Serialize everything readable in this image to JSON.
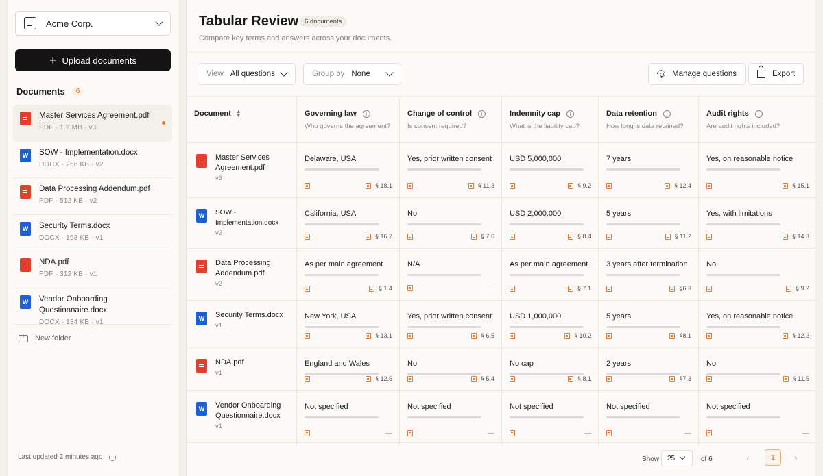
{
  "sidebar": {
    "org": "Acme Corp.",
    "upload_label": "Upload documents",
    "documents_title": "Documents",
    "documents_count": "6",
    "new_folder": "New folder",
    "last_updated": "Last updated 2 minutes ago",
    "docs": [
      {
        "name": "Master Services Agreement.pdf",
        "type": "pdf",
        "meta": "PDF  ·  1.2 MB  ·  v3"
      },
      {
        "name": "SOW - Implementation.docx",
        "type": "doc",
        "meta": "DOCX  ·  256 KB  ·  v2"
      },
      {
        "name": "Data Processing Addendum.pdf",
        "type": "pdf",
        "meta": "PDF  ·  512 KB  ·  v2"
      },
      {
        "name": "Security Terms.docx",
        "type": "doc",
        "meta": "DOCX  ·  198 KB  ·  v1"
      },
      {
        "name": "NDA.pdf",
        "type": "pdf",
        "meta": "PDF  ·  312 KB  ·  v1"
      },
      {
        "name": "Vendor Onboarding Questionnaire.docx",
        "type": "doc",
        "meta": "DOCX  ·  134 KB  ·  v1"
      }
    ]
  },
  "main": {
    "title": "Tabular Review",
    "title_badge": "6 documents",
    "subtitle": "Compare key terms and answers across your documents.",
    "view_label": "View",
    "view_value": "All questions",
    "group_label": "Group by",
    "group_value": "None",
    "manage_label": "Manage questions",
    "export_label": "Export"
  },
  "table": {
    "doc_header": "Document",
    "columns": [
      {
        "title": "Governing law",
        "q": "Who governs the agreement?"
      },
      {
        "title": "Change of control",
        "q": "Is consent required?"
      },
      {
        "title": "Indemnity cap",
        "q": "What is the liability cap?"
      },
      {
        "title": "Data retention",
        "q": "How long is data retained?"
      },
      {
        "title": "Audit rights",
        "q": "Are audit rights included?"
      }
    ],
    "rows": [
      {
        "doc": "Master Services Agreement.pdf",
        "type": "pdf",
        "ver": "v3",
        "cells": [
          [
            "Delaware, USA",
            "§ 18.1"
          ],
          [
            "Yes, prior written consent",
            "§ 11.3"
          ],
          [
            "USD 5,000,000",
            "§ 9.2"
          ],
          [
            "7 years",
            "§ 12.4"
          ],
          [
            "Yes, on reasonable notice",
            "§ 15.1"
          ]
        ]
      },
      {
        "doc": "SOW - Implementation.docx",
        "type": "doc",
        "ver": "v2",
        "cells": [
          [
            "California, USA",
            "§ 16.2"
          ],
          [
            "No",
            "§ 7.6"
          ],
          [
            "USD 2,000,000",
            "§ 8.4"
          ],
          [
            "5 years",
            "§ 11.2"
          ],
          [
            "Yes, with limitations",
            "§ 14.3"
          ]
        ]
      },
      {
        "doc": "Data Processing Addendum.pdf",
        "type": "pdf",
        "ver": "v2",
        "cells": [
          [
            "As per main agreement",
            "§ 1.4"
          ],
          [
            "N/A",
            "—"
          ],
          [
            "As per main agreement",
            "§ 7.1"
          ],
          [
            "3 years after termination",
            "§6.3"
          ],
          [
            "No",
            "§ 9.2"
          ]
        ]
      },
      {
        "doc": "Security Terms.docx",
        "type": "doc",
        "ver": "v1",
        "cells": [
          [
            "New York, USA",
            "§ 13.1"
          ],
          [
            "Yes, prior written consent",
            "§ 6.5"
          ],
          [
            "USD 1,000,000",
            "§ 10.2"
          ],
          [
            "5 years",
            "§8.1"
          ],
          [
            "Yes, on reasonable notice",
            "§ 12.2"
          ]
        ]
      },
      {
        "doc": "NDA.pdf",
        "type": "pdf",
        "ver": "v1",
        "cells": [
          [
            "England and Wales",
            "§ 12.5"
          ],
          [
            "No",
            "§ 5.4"
          ],
          [
            "No cap",
            "§ 8.1"
          ],
          [
            "2 years",
            "§7.3"
          ],
          [
            "No",
            "§ 11.5"
          ]
        ]
      },
      {
        "doc": "Vendor Onboarding Questionnaire.docx",
        "type": "doc",
        "ver": "v1",
        "cells": [
          [
            "Not specified",
            "—"
          ],
          [
            "Not specified",
            "—"
          ],
          [
            "Not specified",
            "—"
          ],
          [
            "Not specified",
            "—"
          ],
          [
            "Not specified",
            "—"
          ]
        ]
      }
    ]
  },
  "footer": {
    "show_label": "Show",
    "page_size": "25",
    "of_label": "of 6",
    "current_page": "1"
  }
}
